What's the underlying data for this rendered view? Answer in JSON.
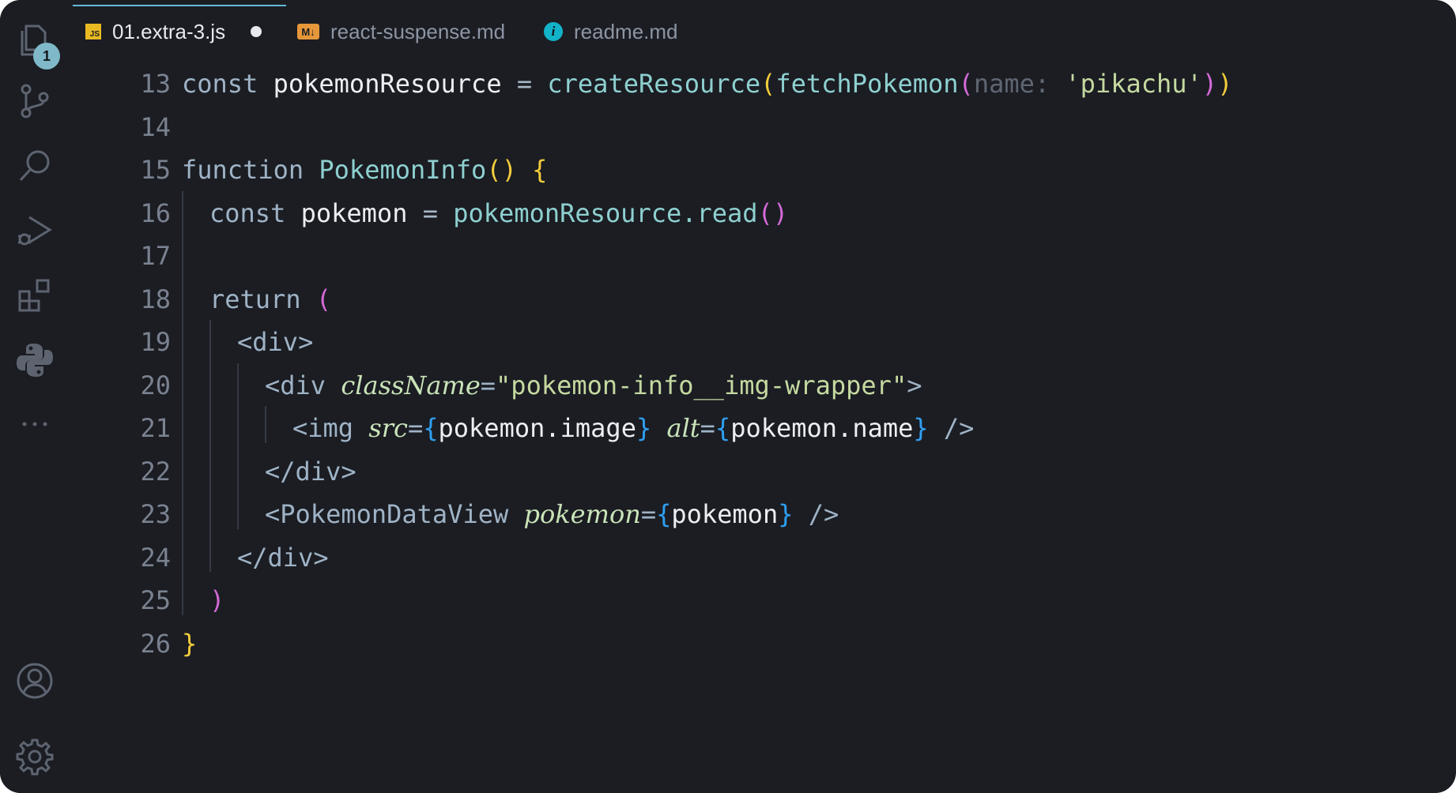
{
  "activity_bar": {
    "explorer_badge": "1",
    "icons": [
      "files-icon",
      "source-control-icon",
      "search-icon",
      "run-debug-icon",
      "extensions-icon",
      "python-icon",
      "more-icon",
      "account-icon",
      "settings-gear-icon"
    ]
  },
  "tabs": [
    {
      "label": "01.extra-3.js",
      "icon_text": "JS",
      "active": true,
      "dirty": true
    },
    {
      "label": "react-suspense.md",
      "icon_text": "M↓",
      "active": false
    },
    {
      "label": "readme.md",
      "icon_text": "i",
      "active": false
    }
  ],
  "editor": {
    "lines": [
      {
        "n": "13",
        "tokens": [
          [
            "kw",
            "const "
          ],
          [
            "var",
            "pokemonResource "
          ],
          [
            "op",
            "= "
          ],
          [
            "fn",
            "createResource"
          ],
          [
            "p1",
            "("
          ],
          [
            "fn",
            "fetchPokemon"
          ],
          [
            "p2",
            "("
          ],
          [
            "hint",
            "name: "
          ],
          [
            "str",
            "'pikachu'"
          ],
          [
            "p2",
            ")"
          ],
          [
            "p1",
            ")"
          ]
        ]
      },
      {
        "n": "14",
        "tokens": []
      },
      {
        "n": "15",
        "tokens": [
          [
            "kw",
            "function "
          ],
          [
            "fn",
            "PokemonInfo"
          ],
          [
            "p1",
            "() {"
          ]
        ]
      },
      {
        "n": "16",
        "tokens": [
          [
            "kw",
            "const "
          ],
          [
            "var",
            "pokemon "
          ],
          [
            "op",
            "= "
          ],
          [
            "fn",
            "pokemonResource.read"
          ],
          [
            "p2",
            "()"
          ]
        ]
      },
      {
        "n": "17",
        "tokens": []
      },
      {
        "n": "18",
        "tokens": [
          [
            "kw",
            "return "
          ],
          [
            "p2",
            "("
          ]
        ]
      },
      {
        "n": "19",
        "tokens": [
          [
            "tag",
            "<div>"
          ]
        ]
      },
      {
        "n": "20",
        "tokens": [
          [
            "tag",
            "<div "
          ],
          [
            "attr",
            "className"
          ],
          [
            "tag",
            "="
          ],
          [
            "str",
            "\"pokemon-info__img-wrapper\""
          ],
          [
            "tag",
            ">"
          ]
        ]
      },
      {
        "n": "21",
        "tokens": [
          [
            "tag",
            "<img "
          ],
          [
            "attr",
            "src"
          ],
          [
            "tag",
            "="
          ],
          [
            "p3",
            "{"
          ],
          [
            "var",
            "pokemon.image"
          ],
          [
            "p3",
            "} "
          ],
          [
            "attr",
            "alt"
          ],
          [
            "tag",
            "="
          ],
          [
            "p3",
            "{"
          ],
          [
            "var",
            "pokemon.name"
          ],
          [
            "p3",
            "} "
          ],
          [
            "tag",
            "/>"
          ]
        ]
      },
      {
        "n": "22",
        "tokens": [
          [
            "tag",
            "</div>"
          ]
        ]
      },
      {
        "n": "23",
        "tokens": [
          [
            "tag",
            "<PokemonDataView "
          ],
          [
            "attr",
            "pokemon"
          ],
          [
            "tag",
            "="
          ],
          [
            "p3",
            "{"
          ],
          [
            "var",
            "pokemon"
          ],
          [
            "p3",
            "} "
          ],
          [
            "tag",
            "/>"
          ]
        ]
      },
      {
        "n": "24",
        "tokens": [
          [
            "tag",
            "</div>"
          ]
        ]
      },
      {
        "n": "25",
        "tokens": [
          [
            "p2",
            ")"
          ]
        ]
      },
      {
        "n": "26",
        "tokens": [
          [
            "p1",
            "}"
          ]
        ]
      }
    ],
    "indent_levels": [
      0,
      0,
      0,
      1,
      0,
      1,
      2,
      3,
      4,
      3,
      3,
      2,
      1,
      0
    ]
  }
}
